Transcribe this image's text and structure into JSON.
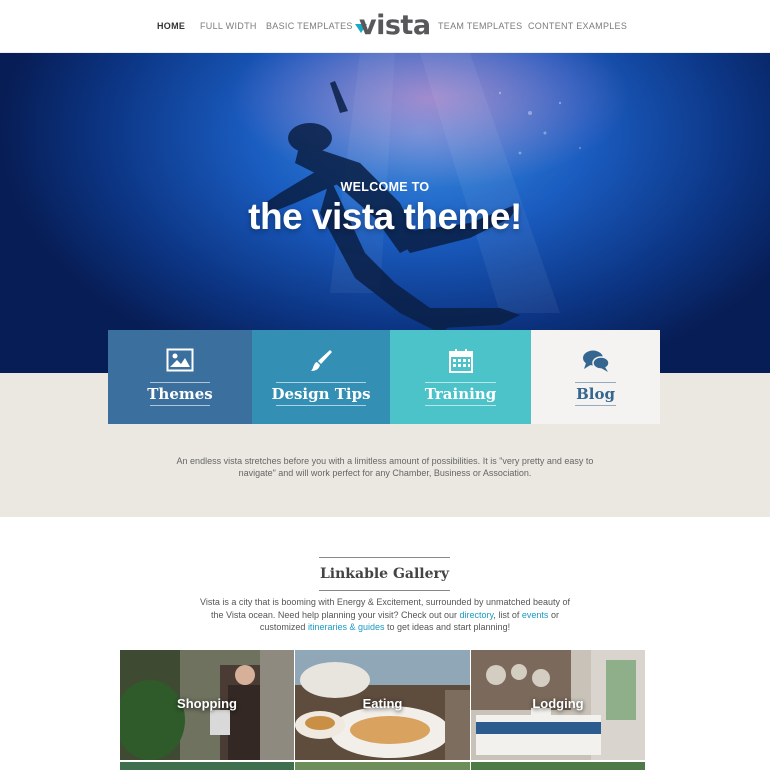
{
  "nav": {
    "left": [
      "HOME",
      "FULL WIDTH",
      "BASIC TEMPLATES"
    ],
    "right": [
      "TEAM TEMPLATES",
      "CONTENT EXAMPLES"
    ],
    "logo": "vista"
  },
  "hero": {
    "kicker": "WELCOME TO",
    "title": "the vista theme!"
  },
  "tiles": [
    {
      "label": "Themes",
      "icon": "image-icon",
      "color": "#3b6f9d"
    },
    {
      "label": "Design Tips",
      "icon": "paintbrush-icon",
      "color": "#338fb3"
    },
    {
      "label": "Training",
      "icon": "calendar-icon",
      "color": "#4cc2c9"
    },
    {
      "label": "Blog",
      "icon": "comments-icon",
      "color": "#f4f3f1"
    }
  ],
  "intro": {
    "line1": "An endless vista stretches before you with a limitless amount of possibilities. It is \"very pretty and easy to",
    "line2": "navigate\" and will work perfect for any Chamber, Business or Association."
  },
  "gallery": {
    "title": "Linkable Gallery",
    "p1": "Vista is a city that is booming with Energy & Excitement, surrounded by unmatched beauty of",
    "p2a": "the Vista ocean. Need help planning your visit? Check out our ",
    "link_directory": "directory",
    "p2b": ", list of ",
    "link_events": "events",
    "p2c": " or",
    "p3a": "customized ",
    "link_itineraries": "itineraries & guides",
    "p3b": " to get ideas and start planning!",
    "items": [
      "Shopping",
      "Eating",
      "Lodging"
    ]
  }
}
